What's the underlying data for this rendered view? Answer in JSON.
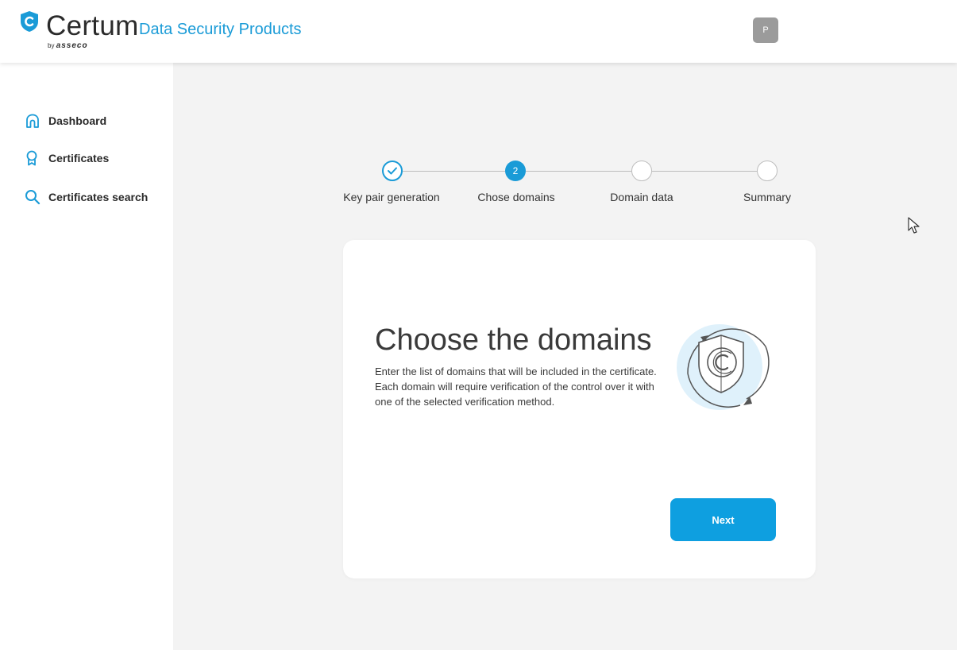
{
  "header": {
    "brand": "Certum",
    "byline_prefix": "by",
    "byline_company": "asseco",
    "tagline": "Data Security Products",
    "avatar_initial": "P",
    "accent_color": "#1a9bd7"
  },
  "sidebar": {
    "items": [
      {
        "label": "Dashboard",
        "icon": "home-icon"
      },
      {
        "label": "Certificates",
        "icon": "award-icon"
      },
      {
        "label": "Certificates search",
        "icon": "search-icon"
      }
    ]
  },
  "stepper": {
    "steps": [
      {
        "label": "Key pair generation",
        "state": "done",
        "marker": ""
      },
      {
        "label": "Chose domains",
        "state": "active",
        "marker": "2"
      },
      {
        "label": "Domain data",
        "state": "todo",
        "marker": ""
      },
      {
        "label": "Summary",
        "state": "todo",
        "marker": ""
      }
    ]
  },
  "card": {
    "title": "Choose the domains",
    "description": "Enter the list of domains that will be included in the certificate. Each domain will require verification of the control over it with one of the selected verification method.",
    "illustration": "shield-certificate-icon",
    "next_label": "Next",
    "button_color": "#0e9fe0"
  }
}
